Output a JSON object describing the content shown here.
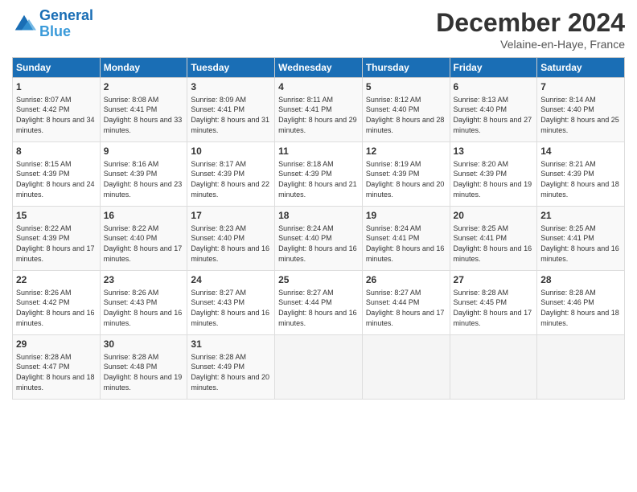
{
  "header": {
    "logo_line1": "General",
    "logo_line2": "Blue",
    "month": "December 2024",
    "location": "Velaine-en-Haye, France"
  },
  "weekdays": [
    "Sunday",
    "Monday",
    "Tuesday",
    "Wednesday",
    "Thursday",
    "Friday",
    "Saturday"
  ],
  "weeks": [
    [
      {
        "day": "1",
        "sunrise": "Sunrise: 8:07 AM",
        "sunset": "Sunset: 4:42 PM",
        "daylight": "Daylight: 8 hours and 34 minutes."
      },
      {
        "day": "2",
        "sunrise": "Sunrise: 8:08 AM",
        "sunset": "Sunset: 4:41 PM",
        "daylight": "Daylight: 8 hours and 33 minutes."
      },
      {
        "day": "3",
        "sunrise": "Sunrise: 8:09 AM",
        "sunset": "Sunset: 4:41 PM",
        "daylight": "Daylight: 8 hours and 31 minutes."
      },
      {
        "day": "4",
        "sunrise": "Sunrise: 8:11 AM",
        "sunset": "Sunset: 4:41 PM",
        "daylight": "Daylight: 8 hours and 29 minutes."
      },
      {
        "day": "5",
        "sunrise": "Sunrise: 8:12 AM",
        "sunset": "Sunset: 4:40 PM",
        "daylight": "Daylight: 8 hours and 28 minutes."
      },
      {
        "day": "6",
        "sunrise": "Sunrise: 8:13 AM",
        "sunset": "Sunset: 4:40 PM",
        "daylight": "Daylight: 8 hours and 27 minutes."
      },
      {
        "day": "7",
        "sunrise": "Sunrise: 8:14 AM",
        "sunset": "Sunset: 4:40 PM",
        "daylight": "Daylight: 8 hours and 25 minutes."
      }
    ],
    [
      {
        "day": "8",
        "sunrise": "Sunrise: 8:15 AM",
        "sunset": "Sunset: 4:39 PM",
        "daylight": "Daylight: 8 hours and 24 minutes."
      },
      {
        "day": "9",
        "sunrise": "Sunrise: 8:16 AM",
        "sunset": "Sunset: 4:39 PM",
        "daylight": "Daylight: 8 hours and 23 minutes."
      },
      {
        "day": "10",
        "sunrise": "Sunrise: 8:17 AM",
        "sunset": "Sunset: 4:39 PM",
        "daylight": "Daylight: 8 hours and 22 minutes."
      },
      {
        "day": "11",
        "sunrise": "Sunrise: 8:18 AM",
        "sunset": "Sunset: 4:39 PM",
        "daylight": "Daylight: 8 hours and 21 minutes."
      },
      {
        "day": "12",
        "sunrise": "Sunrise: 8:19 AM",
        "sunset": "Sunset: 4:39 PM",
        "daylight": "Daylight: 8 hours and 20 minutes."
      },
      {
        "day": "13",
        "sunrise": "Sunrise: 8:20 AM",
        "sunset": "Sunset: 4:39 PM",
        "daylight": "Daylight: 8 hours and 19 minutes."
      },
      {
        "day": "14",
        "sunrise": "Sunrise: 8:21 AM",
        "sunset": "Sunset: 4:39 PM",
        "daylight": "Daylight: 8 hours and 18 minutes."
      }
    ],
    [
      {
        "day": "15",
        "sunrise": "Sunrise: 8:22 AM",
        "sunset": "Sunset: 4:39 PM",
        "daylight": "Daylight: 8 hours and 17 minutes."
      },
      {
        "day": "16",
        "sunrise": "Sunrise: 8:22 AM",
        "sunset": "Sunset: 4:40 PM",
        "daylight": "Daylight: 8 hours and 17 minutes."
      },
      {
        "day": "17",
        "sunrise": "Sunrise: 8:23 AM",
        "sunset": "Sunset: 4:40 PM",
        "daylight": "Daylight: 8 hours and 16 minutes."
      },
      {
        "day": "18",
        "sunrise": "Sunrise: 8:24 AM",
        "sunset": "Sunset: 4:40 PM",
        "daylight": "Daylight: 8 hours and 16 minutes."
      },
      {
        "day": "19",
        "sunrise": "Sunrise: 8:24 AM",
        "sunset": "Sunset: 4:41 PM",
        "daylight": "Daylight: 8 hours and 16 minutes."
      },
      {
        "day": "20",
        "sunrise": "Sunrise: 8:25 AM",
        "sunset": "Sunset: 4:41 PM",
        "daylight": "Daylight: 8 hours and 16 minutes."
      },
      {
        "day": "21",
        "sunrise": "Sunrise: 8:25 AM",
        "sunset": "Sunset: 4:41 PM",
        "daylight": "Daylight: 8 hours and 16 minutes."
      }
    ],
    [
      {
        "day": "22",
        "sunrise": "Sunrise: 8:26 AM",
        "sunset": "Sunset: 4:42 PM",
        "daylight": "Daylight: 8 hours and 16 minutes."
      },
      {
        "day": "23",
        "sunrise": "Sunrise: 8:26 AM",
        "sunset": "Sunset: 4:43 PM",
        "daylight": "Daylight: 8 hours and 16 minutes."
      },
      {
        "day": "24",
        "sunrise": "Sunrise: 8:27 AM",
        "sunset": "Sunset: 4:43 PM",
        "daylight": "Daylight: 8 hours and 16 minutes."
      },
      {
        "day": "25",
        "sunrise": "Sunrise: 8:27 AM",
        "sunset": "Sunset: 4:44 PM",
        "daylight": "Daylight: 8 hours and 16 minutes."
      },
      {
        "day": "26",
        "sunrise": "Sunrise: 8:27 AM",
        "sunset": "Sunset: 4:44 PM",
        "daylight": "Daylight: 8 hours and 17 minutes."
      },
      {
        "day": "27",
        "sunrise": "Sunrise: 8:28 AM",
        "sunset": "Sunset: 4:45 PM",
        "daylight": "Daylight: 8 hours and 17 minutes."
      },
      {
        "day": "28",
        "sunrise": "Sunrise: 8:28 AM",
        "sunset": "Sunset: 4:46 PM",
        "daylight": "Daylight: 8 hours and 18 minutes."
      }
    ],
    [
      {
        "day": "29",
        "sunrise": "Sunrise: 8:28 AM",
        "sunset": "Sunset: 4:47 PM",
        "daylight": "Daylight: 8 hours and 18 minutes."
      },
      {
        "day": "30",
        "sunrise": "Sunrise: 8:28 AM",
        "sunset": "Sunset: 4:48 PM",
        "daylight": "Daylight: 8 hours and 19 minutes."
      },
      {
        "day": "31",
        "sunrise": "Sunrise: 8:28 AM",
        "sunset": "Sunset: 4:49 PM",
        "daylight": "Daylight: 8 hours and 20 minutes."
      },
      null,
      null,
      null,
      null
    ]
  ]
}
